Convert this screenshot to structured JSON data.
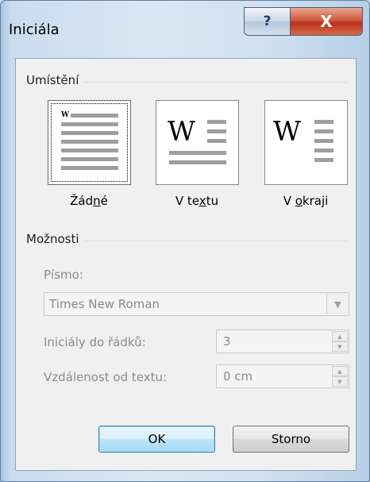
{
  "window": {
    "title": "Iniciála",
    "help_label": "?",
    "close_label": "X"
  },
  "placement": {
    "group_label": "Umístění",
    "options": [
      {
        "label_pre": "Žád",
        "label_key": "n",
        "label_post": "é",
        "selected": true
      },
      {
        "label_pre": "V te",
        "label_key": "x",
        "label_post": "tu",
        "selected": false
      },
      {
        "label_pre": "V ",
        "label_key": "o",
        "label_post": "kraji",
        "selected": false
      }
    ],
    "glyph": "W"
  },
  "options": {
    "group_label": "Možnosti",
    "font_label": "Písmo:",
    "font_value": "Times New Roman",
    "lines_label": "Iniciály do řádků:",
    "lines_value": "3",
    "distance_label": "Vzdálenost od textu:",
    "distance_value": "0 cm"
  },
  "buttons": {
    "ok": "OK",
    "cancel": "Storno"
  },
  "colors": {
    "default_button_border": "#3c7fb1",
    "close_button": "#c8442a"
  },
  "icons": {
    "dropdown": "chevron-down-icon",
    "spin_up": "chevron-up-icon",
    "spin_down": "chevron-down-icon"
  }
}
